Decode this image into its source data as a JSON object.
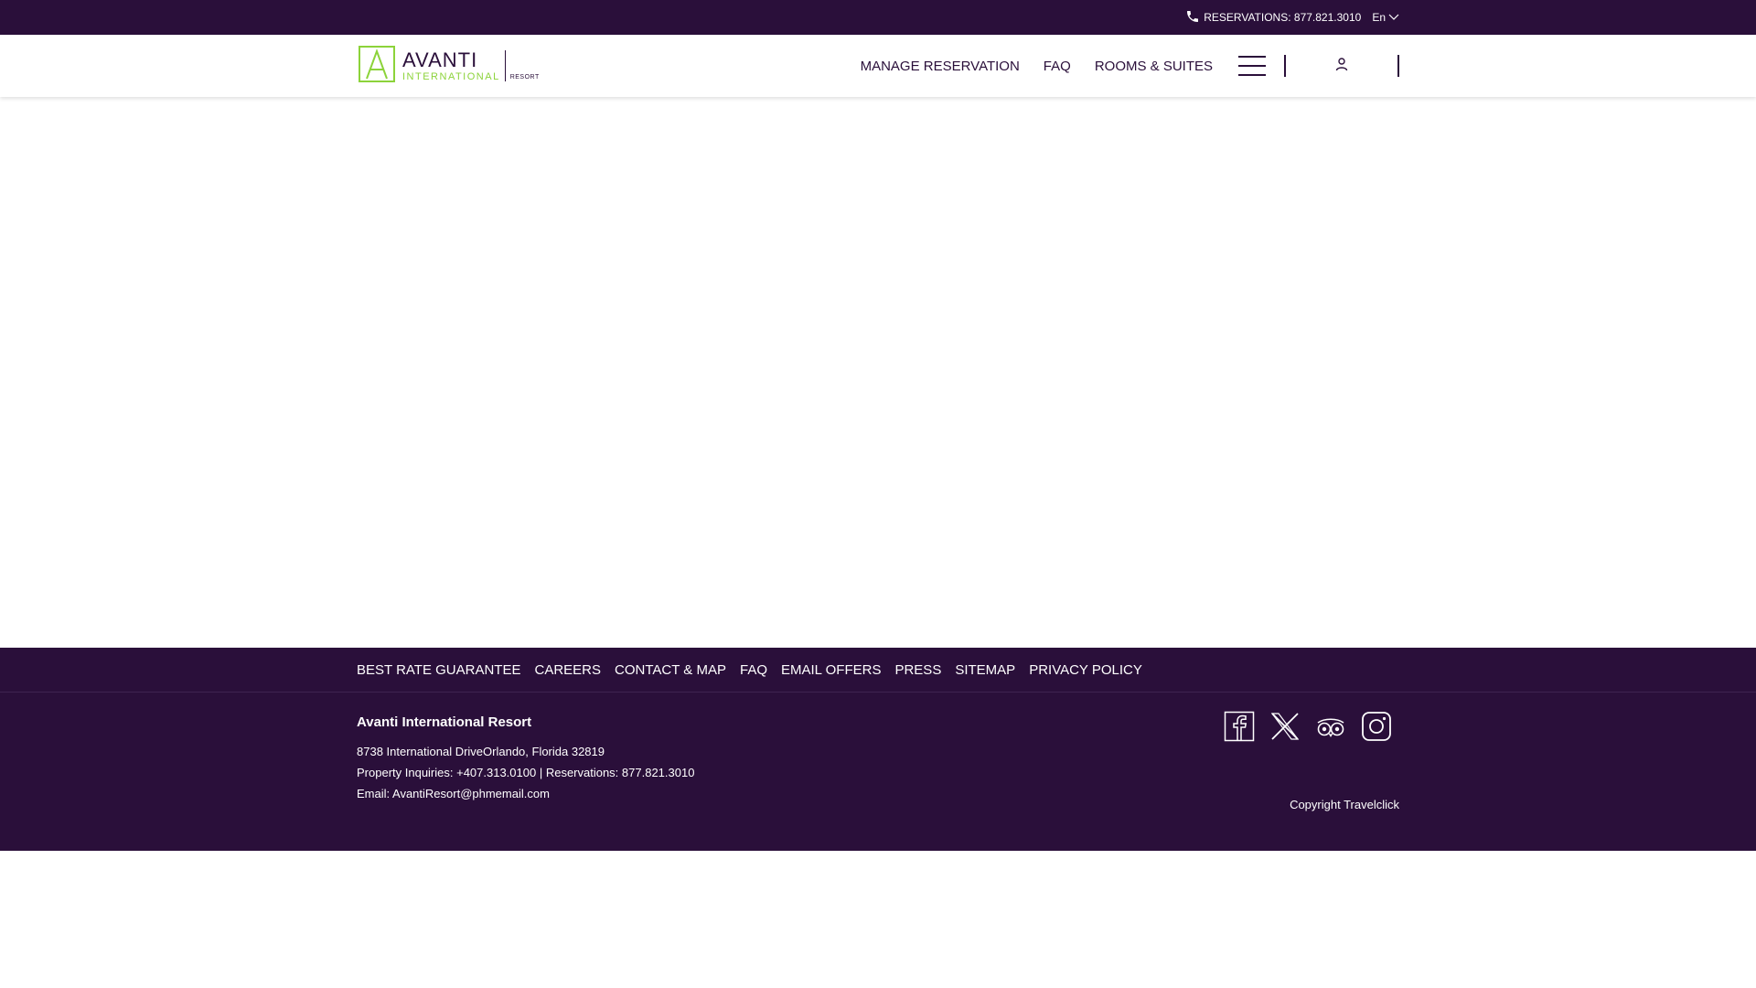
{
  "topbar": {
    "reservations": "RESERVATIONS: 877.821.3010",
    "language": "En"
  },
  "logo": {
    "main": "AVANTI",
    "sub": "INTERNATIONAL",
    "tag": "RESORT"
  },
  "nav": {
    "items": [
      "MANAGE RESERVATION",
      "FAQ",
      "ROOMS & SUITES"
    ]
  },
  "footer_links": [
    "BEST RATE GUARANTEE",
    "CAREERS",
    "CONTACT & MAP",
    "FAQ",
    "EMAIL OFFERS",
    "PRESS",
    "SITEMAP",
    "PRIVACY POLICY"
  ],
  "footer": {
    "name": "Avanti International Resort",
    "address": "8738 International DriveOrlando, Florida 32819",
    "phones": "Property Inquiries: +407.313.0100 | Reservations: 877.821.3010",
    "email": "Email: AvantiResort@phmemail.com",
    "copyright": "Copyright Travelclick"
  },
  "social": [
    "facebook-icon",
    "x-twitter-icon",
    "tripadvisor-icon",
    "instagram-icon"
  ],
  "colors": {
    "brand": "#2a0f3a",
    "accent": "#8cd33a"
  }
}
